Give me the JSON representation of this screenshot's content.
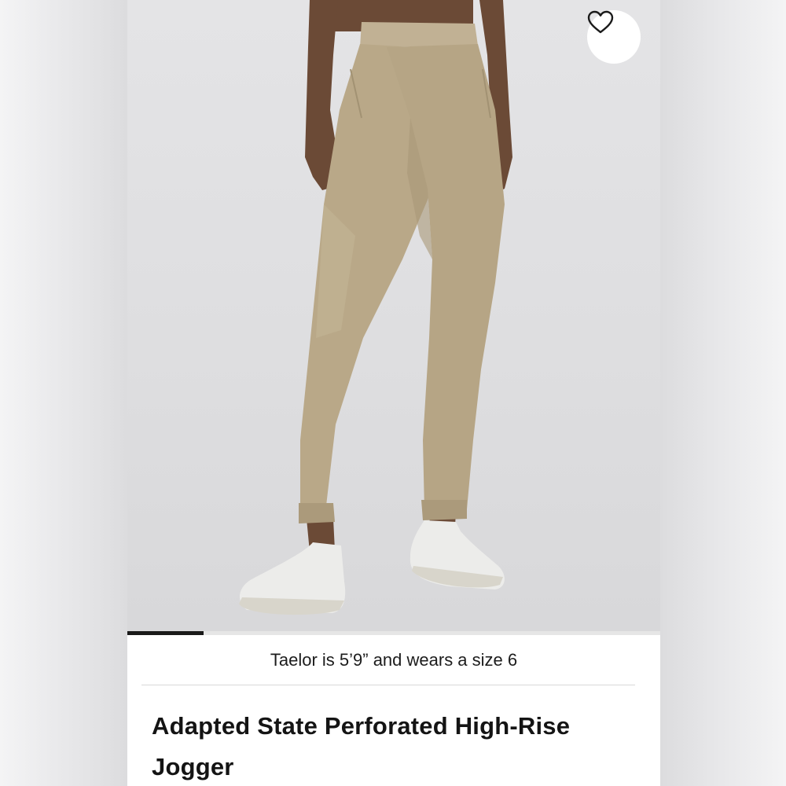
{
  "product": {
    "image_alt": "Adapted State Perforated High-Rise Jogger product photo",
    "model_caption": "Taelor is 5’9” and wears a size 6",
    "title": "Adapted State Perforated High-Rise Jogger",
    "favorite_icon": "heart-outline-icon"
  },
  "gallery": {
    "progress_fraction": 0.143
  },
  "colors": {
    "fabric": "#b9a888",
    "skin": "#6b4a36",
    "shoe": "#ececea"
  }
}
